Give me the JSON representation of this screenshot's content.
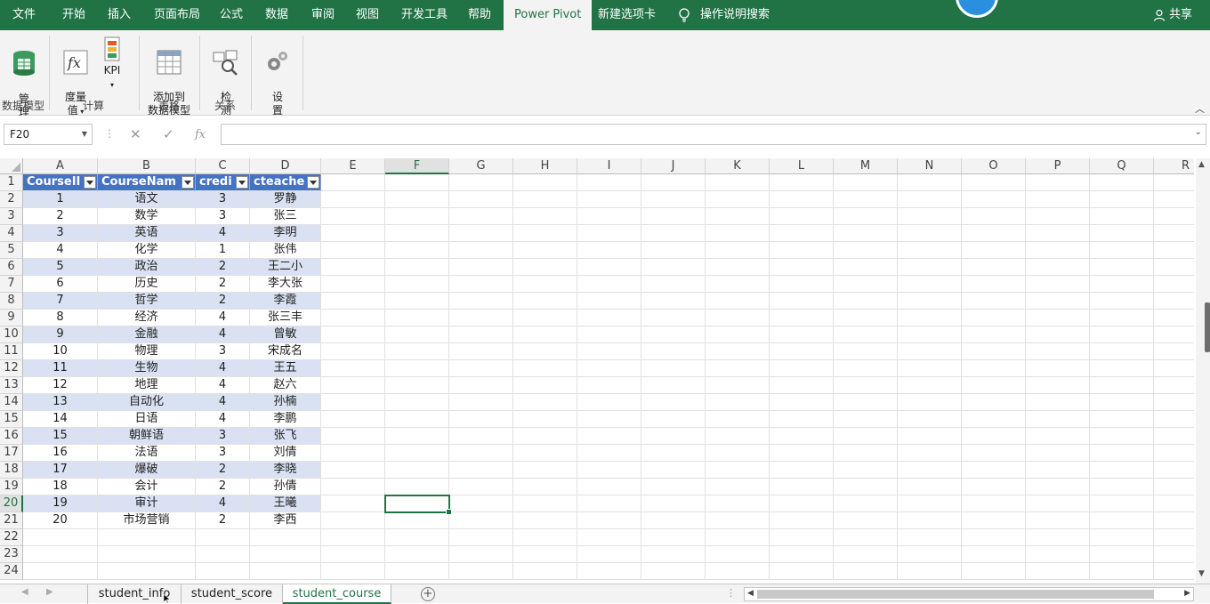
{
  "ribbon": {
    "tabs": [
      "文件",
      "开始",
      "插入",
      "页面布局",
      "公式",
      "数据",
      "审阅",
      "视图",
      "开发工具",
      "帮助",
      "Power Pivot",
      "新建选项卡"
    ],
    "active_tab": "Power Pivot",
    "search_label": "操作说明搜索",
    "share_label": "共享",
    "buttons": {
      "manage": "管\n理",
      "measure": "度量\n值",
      "kpi": "KPI",
      "add_to_model": "添加到\n数据模型",
      "detect": "检\n测",
      "settings": "设\n置"
    },
    "groups": {
      "data_model": "数据模型",
      "calc": "计算",
      "table": "表格",
      "relations": "关系"
    }
  },
  "formula_bar": {
    "name_box": "F20",
    "formula": "",
    "fx_label": "fx"
  },
  "grid": {
    "columns": [
      "A",
      "B",
      "C",
      "D",
      "E",
      "F",
      "G",
      "H",
      "I",
      "J",
      "K",
      "L",
      "M",
      "N",
      "O",
      "P",
      "Q",
      "R"
    ],
    "selected_column": "F",
    "selected_row": 20,
    "row_numbers": [
      1,
      2,
      3,
      4,
      5,
      6,
      7,
      8,
      9,
      10,
      11,
      12,
      13,
      14,
      15,
      16,
      17,
      18,
      19,
      20,
      21,
      22,
      23,
      24
    ],
    "table_headers": [
      "CourseII",
      "CourseNam",
      "credi",
      "cteache"
    ],
    "table_rows": [
      [
        "1",
        "语文",
        "3",
        "罗静"
      ],
      [
        "2",
        "数学",
        "3",
        "张三"
      ],
      [
        "3",
        "英语",
        "4",
        "李明"
      ],
      [
        "4",
        "化学",
        "1",
        "张伟"
      ],
      [
        "5",
        "政治",
        "2",
        "王二小"
      ],
      [
        "6",
        "历史",
        "2",
        "李大张"
      ],
      [
        "7",
        "哲学",
        "2",
        "李霞"
      ],
      [
        "8",
        "经济",
        "4",
        "张三丰"
      ],
      [
        "9",
        "金融",
        "4",
        "曾敏"
      ],
      [
        "10",
        "物理",
        "3",
        "宋成名"
      ],
      [
        "11",
        "生物",
        "4",
        "王五"
      ],
      [
        "12",
        "地理",
        "4",
        "赵六"
      ],
      [
        "13",
        "自动化",
        "4",
        "孙楠"
      ],
      [
        "14",
        "日语",
        "4",
        "李鹏"
      ],
      [
        "15",
        "朝鲜语",
        "3",
        "张飞"
      ],
      [
        "16",
        "法语",
        "3",
        "刘倩"
      ],
      [
        "17",
        "爆破",
        "2",
        "李晓"
      ],
      [
        "18",
        "会计",
        "2",
        "孙倩"
      ],
      [
        "19",
        "审计",
        "4",
        "王曦"
      ],
      [
        "20",
        "市场营销",
        "2",
        "李西"
      ]
    ]
  },
  "sheets": {
    "tabs": [
      "student_info",
      "student_score",
      "student_course"
    ],
    "active": "student_course"
  },
  "colors": {
    "excel_green": "#217346",
    "table_header": "#4472c4",
    "table_band": "#d9e1f2"
  }
}
